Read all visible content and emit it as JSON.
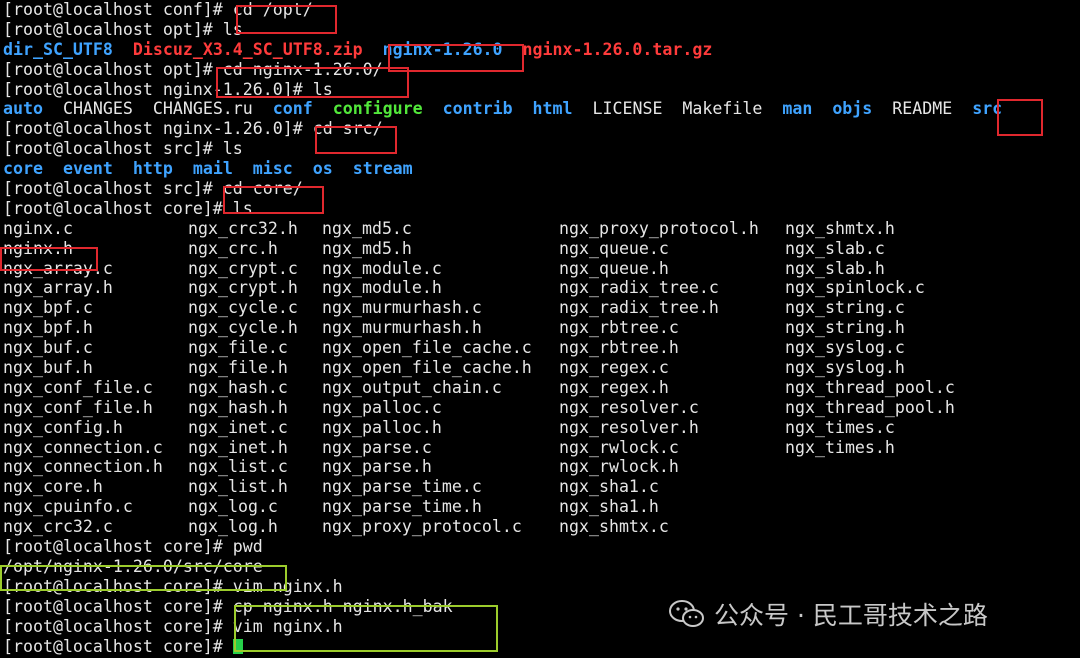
{
  "colors": {
    "prompt": "#e6e6e6",
    "directory": "#3fa3ff",
    "executable": "#52e83a",
    "archive": "#ff3b3b",
    "highlight_red": "#e0282e",
    "highlight_green": "#9ccc2c",
    "cursor": "#26d14a"
  },
  "terminal": {
    "lines": [
      {
        "type": "cmd",
        "prompt": "[root@localhost conf]# ",
        "command": "cd /opt/"
      },
      {
        "type": "cmd",
        "prompt": "[root@localhost opt]# ",
        "command": "ls"
      },
      {
        "type": "listing",
        "items": [
          {
            "text": "dir_SC_UTF8",
            "kind": "directory"
          },
          {
            "text": "Discuz_X3.4_SC_UTF8.zip",
            "kind": "archive"
          },
          {
            "text": "nginx-1.26.0",
            "kind": "directory"
          },
          {
            "text": "nginx-1.26.0.tar.gz",
            "kind": "archive"
          }
        ]
      },
      {
        "type": "cmd",
        "prompt": "[root@localhost opt]# ",
        "command": "cd nginx-1.26.0/"
      },
      {
        "type": "cmd",
        "prompt": "[root@localhost nginx-1.26.0]# ",
        "command": "ls"
      },
      {
        "type": "listing",
        "items": [
          {
            "text": "auto",
            "kind": "directory"
          },
          {
            "text": "CHANGES",
            "kind": "file"
          },
          {
            "text": "CHANGES.ru",
            "kind": "file"
          },
          {
            "text": "conf",
            "kind": "directory"
          },
          {
            "text": "configure",
            "kind": "executable"
          },
          {
            "text": "contrib",
            "kind": "directory"
          },
          {
            "text": "html",
            "kind": "directory"
          },
          {
            "text": "LICENSE",
            "kind": "file"
          },
          {
            "text": "Makefile",
            "kind": "file"
          },
          {
            "text": "man",
            "kind": "directory"
          },
          {
            "text": "objs",
            "kind": "directory"
          },
          {
            "text": "README",
            "kind": "file"
          },
          {
            "text": "src",
            "kind": "directory"
          }
        ]
      },
      {
        "type": "cmd",
        "prompt": "[root@localhost nginx-1.26.0]# ",
        "command": "cd src/"
      },
      {
        "type": "cmd",
        "prompt": "[root@localhost src]# ",
        "command": "ls"
      },
      {
        "type": "listing",
        "items": [
          {
            "text": "core",
            "kind": "directory"
          },
          {
            "text": "event",
            "kind": "directory"
          },
          {
            "text": "http",
            "kind": "directory"
          },
          {
            "text": "mail",
            "kind": "directory"
          },
          {
            "text": "misc",
            "kind": "directory"
          },
          {
            "text": "os",
            "kind": "directory"
          },
          {
            "text": "stream",
            "kind": "directory"
          }
        ]
      },
      {
        "type": "cmd",
        "prompt": "[root@localhost src]# ",
        "command": "cd core/"
      },
      {
        "type": "cmd",
        "prompt": "[root@localhost core]# ",
        "command": "ls"
      }
    ],
    "file_grid": [
      [
        "nginx.c",
        "ngx_crc32.h",
        "ngx_md5.c",
        "ngx_proxy_protocol.h",
        "ngx_shmtx.h"
      ],
      [
        "nginx.h",
        "ngx_crc.h",
        "ngx_md5.h",
        "ngx_queue.c",
        "ngx_slab.c"
      ],
      [
        "ngx_array.c",
        "ngx_crypt.c",
        "ngx_module.c",
        "ngx_queue.h",
        "ngx_slab.h"
      ],
      [
        "ngx_array.h",
        "ngx_crypt.h",
        "ngx_module.h",
        "ngx_radix_tree.c",
        "ngx_spinlock.c"
      ],
      [
        "ngx_bpf.c",
        "ngx_cycle.c",
        "ngx_murmurhash.c",
        "ngx_radix_tree.h",
        "ngx_string.c"
      ],
      [
        "ngx_bpf.h",
        "ngx_cycle.h",
        "ngx_murmurhash.h",
        "ngx_rbtree.c",
        "ngx_string.h"
      ],
      [
        "ngx_buf.c",
        "ngx_file.c",
        "ngx_open_file_cache.c",
        "ngx_rbtree.h",
        "ngx_syslog.c"
      ],
      [
        "ngx_buf.h",
        "ngx_file.h",
        "ngx_open_file_cache.h",
        "ngx_regex.c",
        "ngx_syslog.h"
      ],
      [
        "ngx_conf_file.c",
        "ngx_hash.c",
        "ngx_output_chain.c",
        "ngx_regex.h",
        "ngx_thread_pool.c"
      ],
      [
        "ngx_conf_file.h",
        "ngx_hash.h",
        "ngx_palloc.c",
        "ngx_resolver.c",
        "ngx_thread_pool.h"
      ],
      [
        "ngx_config.h",
        "ngx_inet.c",
        "ngx_palloc.h",
        "ngx_resolver.h",
        "ngx_times.c"
      ],
      [
        "ngx_connection.c",
        "ngx_inet.h",
        "ngx_parse.c",
        "ngx_rwlock.c",
        "ngx_times.h"
      ],
      [
        "ngx_connection.h",
        "ngx_list.c",
        "ngx_parse.h",
        "ngx_rwlock.h",
        ""
      ],
      [
        "ngx_core.h",
        "ngx_list.h",
        "ngx_parse_time.c",
        "ngx_sha1.c",
        ""
      ],
      [
        "ngx_cpuinfo.c",
        "ngx_log.c",
        "ngx_parse_time.h",
        "ngx_sha1.h",
        ""
      ],
      [
        "ngx_crc32.c",
        "ngx_log.h",
        "ngx_proxy_protocol.c",
        "ngx_shmtx.c",
        ""
      ]
    ],
    "tail_lines": [
      {
        "type": "cmd",
        "prompt": "[root@localhost core]# ",
        "command": "pwd"
      },
      {
        "type": "output",
        "text": "/opt/nginx-1.26.0/src/core"
      },
      {
        "type": "cmd",
        "prompt": "[root@localhost core]# ",
        "command": "vim nginx.h"
      },
      {
        "type": "cmd",
        "prompt": "[root@localhost core]# ",
        "command": "cp nginx.h nginx.h_bak"
      },
      {
        "type": "cmd",
        "prompt": "[root@localhost core]# ",
        "command": "vim nginx.h"
      },
      {
        "type": "prompt",
        "prompt": "[root@localhost core]# ",
        "command": ""
      }
    ]
  },
  "watermark": {
    "icon": "wechat-icon",
    "text": "公众号 · 民工哥技术之路"
  }
}
